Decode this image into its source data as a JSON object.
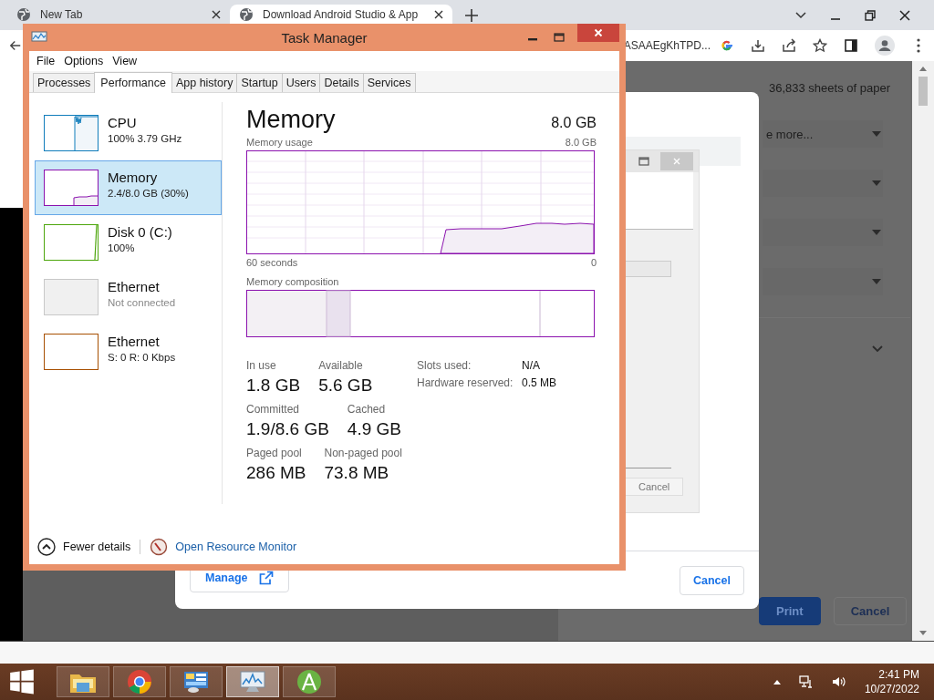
{
  "browser": {
    "tabs": [
      {
        "title": "New Tab",
        "selected": false
      },
      {
        "title": "Download Android Studio & App",
        "selected": true
      }
    ],
    "address": "ASAAEgKhTPD..."
  },
  "print_preview": {
    "sheets": "36,833 sheets of paper",
    "rows": [
      {
        "kind": "dropdown",
        "value": "e more..."
      },
      {
        "kind": "dropdown"
      },
      {
        "kind": "dropdown"
      },
      {
        "kind": "dropdown"
      },
      {
        "kind": "expander"
      }
    ],
    "buttons": [
      {
        "label": "Print",
        "kind": "primary"
      },
      {
        "label": "Cancel",
        "kind": "secondary"
      }
    ]
  },
  "dialog": {
    "manage": "Manage",
    "cancel": "Cancel",
    "inner_window": {
      "cancel": "Cancel"
    }
  },
  "task_manager": {
    "title": "Task Manager",
    "menu": [
      "File",
      "Options",
      "View"
    ],
    "tabs": [
      {
        "label": "Processes",
        "selected": false
      },
      {
        "label": "Performance",
        "selected": true
      },
      {
        "label": "App history",
        "selected": false
      },
      {
        "label": "Startup",
        "selected": false
      },
      {
        "label": "Users",
        "selected": false
      },
      {
        "label": "Details",
        "selected": false
      },
      {
        "label": "Services",
        "selected": false
      }
    ],
    "resources": [
      {
        "kind": "cpu",
        "name": "CPU",
        "detail": "100%  3.79 GHz",
        "color": "#117dbb",
        "selected": false,
        "dimmed": false
      },
      {
        "kind": "memory",
        "name": "Memory",
        "detail": "2.4/8.0 GB (30%)",
        "color": "#8b12ae",
        "selected": true,
        "dimmed": false
      },
      {
        "kind": "disk",
        "name": "Disk 0 (C:)",
        "detail": "100%",
        "color": "#4da60c",
        "selected": false,
        "dimmed": false
      },
      {
        "kind": "idle",
        "name": "Ethernet",
        "detail": "Not connected",
        "color": "#c8c8c8",
        "selected": false,
        "dimmed": true
      },
      {
        "kind": "network",
        "name": "Ethernet",
        "detail": "S: 0 R: 0 Kbps",
        "color": "#a74f01",
        "selected": false,
        "dimmed": false
      }
    ],
    "detail": {
      "title": "Memory",
      "total": "8.0 GB",
      "usage_label": "Memory usage",
      "usage_max": "8.0 GB",
      "time_span": "60 seconds",
      "time_end": "0",
      "composition_label": "Memory composition",
      "stats": [
        {
          "label": "In use",
          "value": "1.8 GB"
        },
        {
          "label": "Available",
          "value": "5.6 GB"
        },
        {
          "label": "Committed",
          "value": "1.9/8.6 GB"
        },
        {
          "label": "Cached",
          "value": "4.9 GB"
        },
        {
          "label": "Paged pool",
          "value": "286 MB"
        },
        {
          "label": "Non-paged pool",
          "value": "73.8 MB"
        }
      ],
      "properties": [
        {
          "label": "Slots used:",
          "value": "N/A"
        },
        {
          "label": "Hardware reserved:",
          "value": "0.5 MB"
        }
      ]
    },
    "footer": {
      "fewer_details": "Fewer details",
      "resource_monitor": "Open Resource Monitor"
    }
  },
  "taskbar": {
    "apps": [
      {
        "kind": "explorer",
        "selected": false
      },
      {
        "kind": "browser",
        "selected": false
      },
      {
        "kind": "control",
        "selected": false
      },
      {
        "kind": "monitor",
        "selected": true
      },
      {
        "kind": "studio",
        "selected": false
      }
    ],
    "time": "2:41 PM",
    "date": "10/27/2022"
  }
}
